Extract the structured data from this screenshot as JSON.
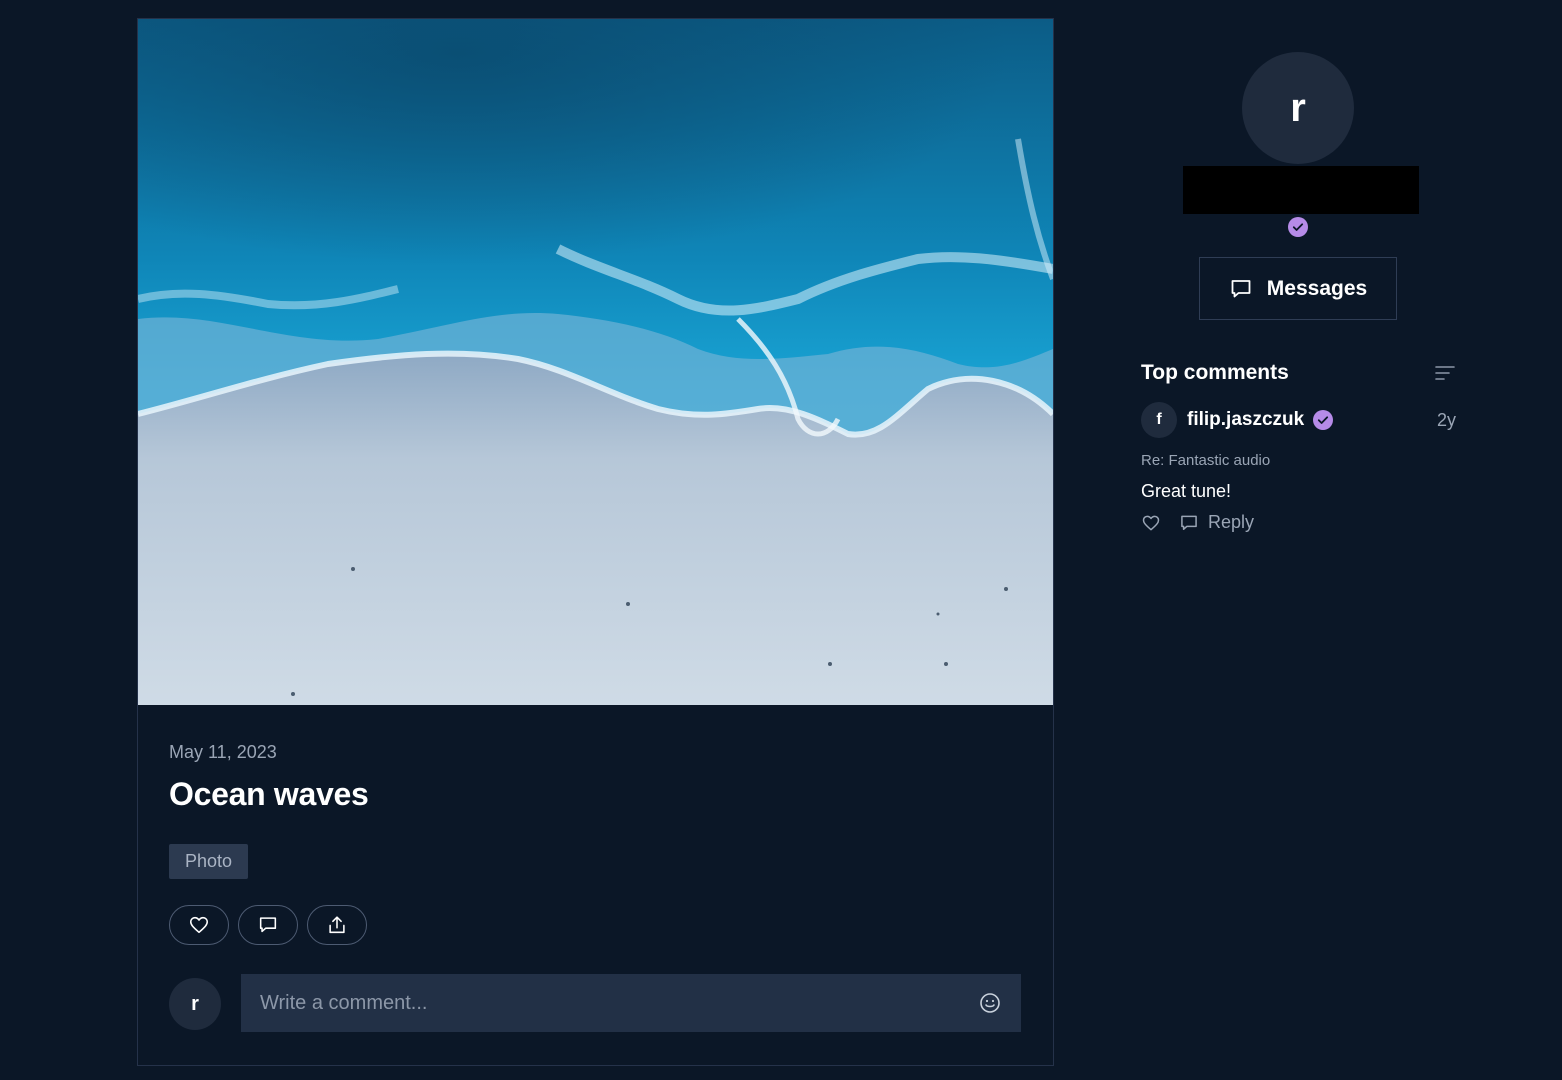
{
  "post": {
    "date": "May 11, 2023",
    "title": "Ocean waves",
    "tag": "Photo",
    "actions": [
      "heart-icon",
      "comment-icon",
      "share-icon"
    ]
  },
  "composer": {
    "avatar_initial": "r",
    "placeholder": "Write a comment..."
  },
  "profile": {
    "avatar_initial": "r",
    "messages_label": "Messages"
  },
  "top_comments": {
    "title": "Top comments",
    "items": [
      {
        "avatar_initial": "f",
        "author": "filip.jaszczuk",
        "time": "2y",
        "reference": "Re: Fantastic audio",
        "text": "Great tune!",
        "reply_label": "Reply"
      }
    ]
  },
  "colors": {
    "background": "#0b1727",
    "verified": "#b68be8",
    "input_bg": "#223046"
  }
}
